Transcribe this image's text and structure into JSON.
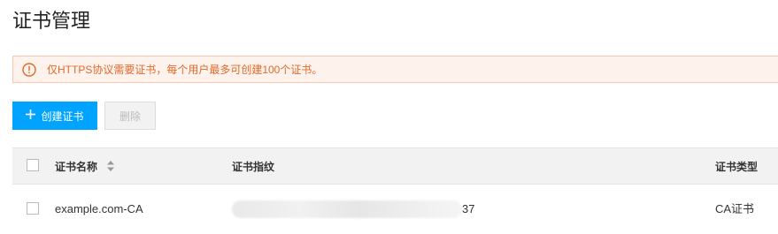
{
  "page": {
    "title": "证书管理"
  },
  "alert": {
    "icon": "warning-circle-icon",
    "text": "仅HTTPS协议需要证书，每个用户最多可创建100个证书。",
    "color": "#e06a2c",
    "background": "#fef2ec"
  },
  "toolbar": {
    "create_label": "创建证书",
    "create_icon": "plus-icon",
    "delete_label": "删除",
    "accent": "#00a4ff"
  },
  "table": {
    "columns": {
      "name": "证书名称",
      "fingerprint": "证书指纹",
      "type": "证书类型"
    },
    "rows": [
      {
        "name": "example.com-CA",
        "fingerprint_visible_suffix": "37",
        "type": "CA证书"
      }
    ]
  }
}
